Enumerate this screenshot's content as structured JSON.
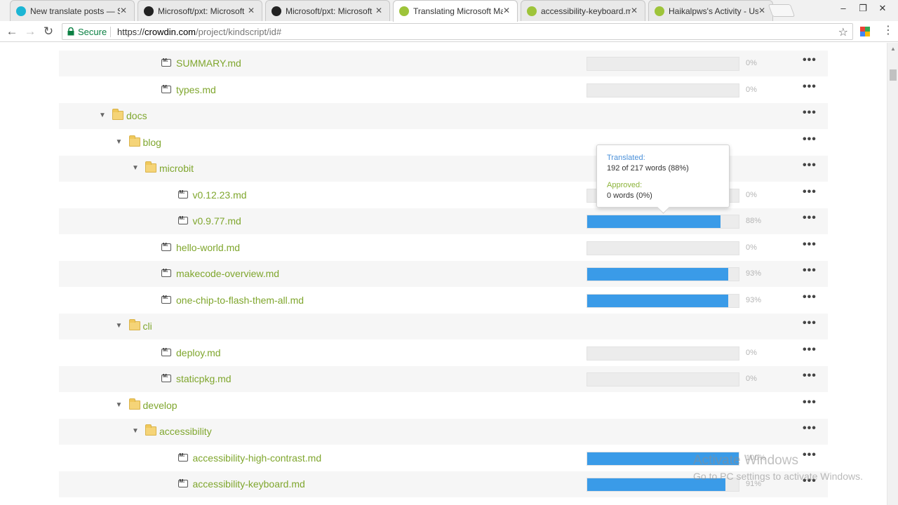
{
  "browser": {
    "tabs": [
      {
        "title": "New translate posts — S",
        "favicon": "discourse-icon",
        "color": "#1bb5d4",
        "active": false
      },
      {
        "title": "Microsoft/pxt: Microsoft",
        "favicon": "github-icon",
        "color": "#222222",
        "active": false
      },
      {
        "title": "Microsoft/pxt: Microsoft",
        "favicon": "github-icon",
        "color": "#222222",
        "active": false
      },
      {
        "title": "Translating Microsoft Ma",
        "favicon": "crowdin-icon",
        "color": "#9ec43a",
        "active": true
      },
      {
        "title": "accessibility-keyboard.m",
        "favicon": "crowdin-icon",
        "color": "#9ec43a",
        "active": false
      },
      {
        "title": "Haikalpws's Activity - Us",
        "favicon": "crowdin-icon",
        "color": "#9ec43a",
        "active": false
      }
    ],
    "tab_close_glyph": "✕",
    "window_buttons": [
      "–",
      "❐",
      "✕"
    ],
    "nav": {
      "back": "←",
      "forward": "→",
      "reload": "↻"
    },
    "secure_label": "Secure",
    "url_scheme": "https://",
    "url_host": "crowdin.com",
    "url_path": "/project/kindscript/id#",
    "star_glyph": "☆",
    "menu_glyph": "⋮"
  },
  "rows": [
    {
      "type": "file",
      "name": "SUMMARY.md",
      "level": 2,
      "progress": 0,
      "pct": "0%"
    },
    {
      "type": "file",
      "name": "types.md",
      "level": 2,
      "progress": 0,
      "pct": "0%"
    },
    {
      "type": "folder",
      "name": "docs",
      "level": 0
    },
    {
      "type": "folder",
      "name": "blog",
      "level": 1
    },
    {
      "type": "folder",
      "name": "microbit",
      "level": 2
    },
    {
      "type": "file",
      "name": "v0.12.23.md",
      "level": 3,
      "progress": 0,
      "pct": "0%"
    },
    {
      "type": "file",
      "name": "v0.9.77.md",
      "level": 3,
      "progress": 0.88,
      "pct": "88%"
    },
    {
      "type": "file",
      "name": "hello-world.md",
      "level": 2,
      "progress": 0,
      "pct": "0%"
    },
    {
      "type": "file",
      "name": "makecode-overview.md",
      "level": 2,
      "progress": 0.93,
      "pct": "93%"
    },
    {
      "type": "file",
      "name": "one-chip-to-flash-them-all.md",
      "level": 2,
      "progress": 0.93,
      "pct": "93%"
    },
    {
      "type": "folder",
      "name": "cli",
      "level": 1
    },
    {
      "type": "file",
      "name": "deploy.md",
      "level": 2,
      "progress": 0,
      "pct": "0%"
    },
    {
      "type": "file",
      "name": "staticpkg.md",
      "level": 2,
      "progress": 0,
      "pct": "0%"
    },
    {
      "type": "folder",
      "name": "develop",
      "level": 1
    },
    {
      "type": "folder",
      "name": "accessibility",
      "level": 2
    },
    {
      "type": "file",
      "name": "accessibility-high-contrast.md",
      "level": 3,
      "progress": 1.0,
      "pct": "100%"
    },
    {
      "type": "file",
      "name": "accessibility-keyboard.md",
      "level": 3,
      "progress": 0.91,
      "pct": "91%"
    }
  ],
  "more_glyph": "•••",
  "caret_glyph": "▼",
  "tooltip": {
    "translated_label": "Translated:",
    "translated_value": "192 of 217 words (88%)",
    "approved_label": "Approved:",
    "approved_value": "0 words (0%)"
  },
  "watermark": {
    "title": "Activate Windows",
    "subtitle": "Go to PC settings to activate Windows."
  },
  "colors": {
    "link_green": "#7fa62d",
    "progress_blue": "#3a9be8",
    "secure_green": "#0b8043"
  }
}
